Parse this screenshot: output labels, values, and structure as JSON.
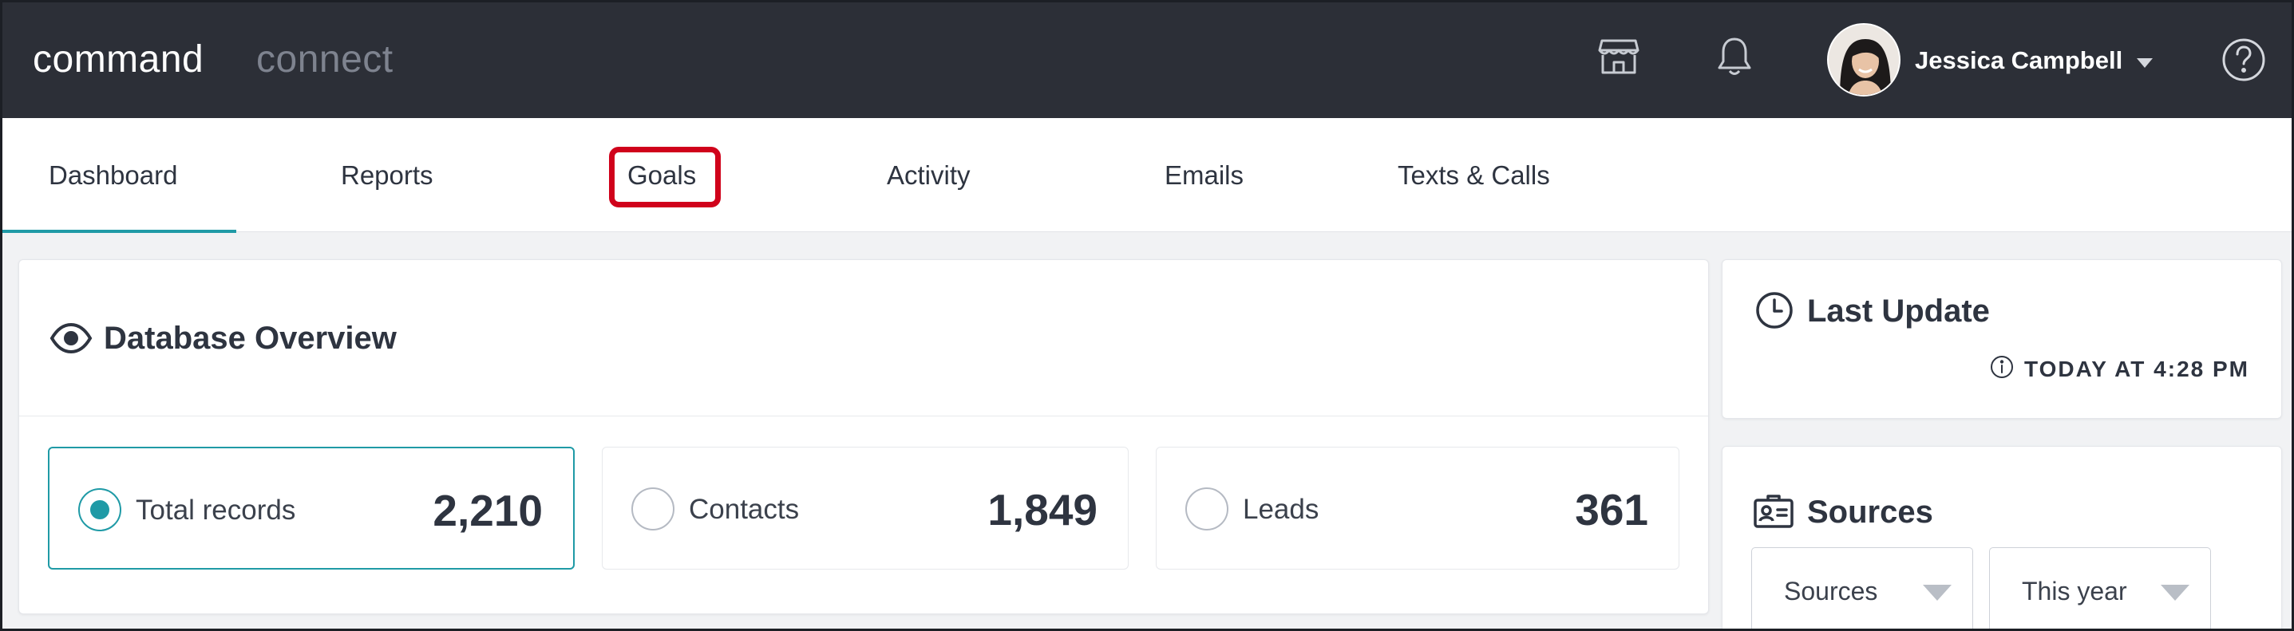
{
  "brand": {
    "primary": "command",
    "secondary": "connect"
  },
  "topbar": {
    "icons": [
      "store-icon",
      "bell-icon",
      "help-icon"
    ],
    "user": {
      "name": "Jessica Campbell"
    }
  },
  "tabs": [
    {
      "label": "Dashboard",
      "active": true
    },
    {
      "label": "Reports",
      "active": false
    },
    {
      "label": "Goals",
      "active": false,
      "highlighted": true
    },
    {
      "label": "Activity",
      "active": false
    },
    {
      "label": "Emails",
      "active": false
    },
    {
      "label": "Texts & Calls",
      "active": false
    }
  ],
  "database_overview": {
    "title": "Database Overview",
    "stats": [
      {
        "label": "Total records",
        "value": "2,210",
        "selected": true
      },
      {
        "label": "Contacts",
        "value": "1,849",
        "selected": false
      },
      {
        "label": "Leads",
        "value": "361",
        "selected": false
      }
    ]
  },
  "last_update": {
    "title": "Last Update",
    "time": "TODAY AT 4:28 PM"
  },
  "sources": {
    "title": "Sources",
    "filters": [
      {
        "value": "Sources"
      },
      {
        "value": "This year"
      }
    ]
  },
  "colors": {
    "topbar": "#2c2f37",
    "accent": "#1f9aa6",
    "highlight": "#d0021b",
    "text": "#2e3440"
  }
}
